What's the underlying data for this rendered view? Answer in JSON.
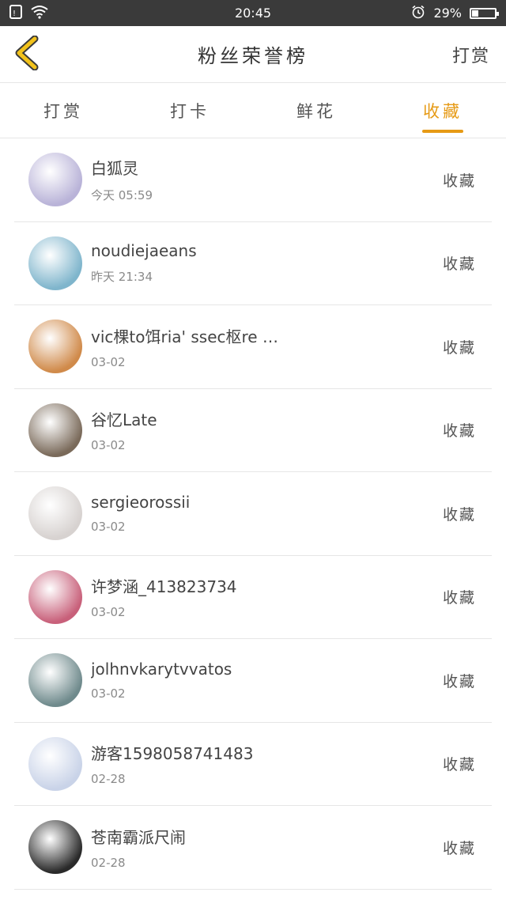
{
  "status_bar": {
    "time": "20:45",
    "battery": "29%",
    "battery_level": 0.29
  },
  "header": {
    "title": "粉丝荣誉榜",
    "action": "打赏"
  },
  "tabs": [
    {
      "label": "打赏",
      "active": false
    },
    {
      "label": "打卡",
      "active": false
    },
    {
      "label": "鲜花",
      "active": false
    },
    {
      "label": "收藏",
      "active": true
    }
  ],
  "colors": {
    "accent": "#e69a15"
  },
  "items": [
    {
      "name": "白狐灵",
      "time": "今天 05:59",
      "type": "收藏",
      "avatar_color": "#b9b3d8"
    },
    {
      "name": "noudiejaeans",
      "time": "昨天 21:34",
      "type": "收藏",
      "avatar_color": "#7fb5cc"
    },
    {
      "name": "vic棵to饵ria' ssec枢re …",
      "time": "03-02",
      "type": "收藏",
      "avatar_color": "#d08a4a"
    },
    {
      "name": "谷忆Late",
      "time": "03-02",
      "type": "收藏",
      "avatar_color": "#7a6a5a"
    },
    {
      "name": "sergieorossii",
      "time": "03-02",
      "type": "收藏",
      "avatar_color": "#d7d2d0"
    },
    {
      "name": "许梦涵_413823734",
      "time": "03-02",
      "type": "收藏",
      "avatar_color": "#c8607a"
    },
    {
      "name": "jolhnvkarytvvatos",
      "time": "03-02",
      "type": "收藏",
      "avatar_color": "#6f8a8c"
    },
    {
      "name": "游客1598058741483",
      "time": "02-28",
      "type": "收藏",
      "avatar_color": "#c9d3e8"
    },
    {
      "name": "苍南霸派尺闹",
      "time": "02-28",
      "type": "收藏",
      "avatar_color": "#2a2a2a"
    }
  ]
}
